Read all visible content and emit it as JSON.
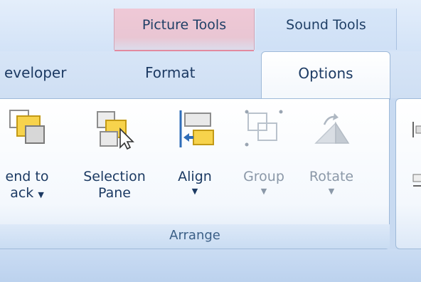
{
  "contextual_tabs": {
    "picture_tools": "Picture Tools",
    "sound_tools": "Sound Tools"
  },
  "tabs": {
    "developer": "eveloper",
    "format": "Format",
    "options": "Options"
  },
  "arrange_group": {
    "label": "Arrange",
    "send_to_back": {
      "line1": "end to",
      "line2": "ack"
    },
    "selection_pane": {
      "line1": "Selection",
      "line2": "Pane"
    },
    "align": {
      "line1": "Align"
    },
    "group": {
      "line1": "Group"
    },
    "rotate": {
      "line1": "Rotate"
    }
  },
  "colors": {
    "picture_tools_accent": "#e9c6d3",
    "sound_tools_accent": "#cfe0f6",
    "icon_yellow": "#f7d34c"
  }
}
